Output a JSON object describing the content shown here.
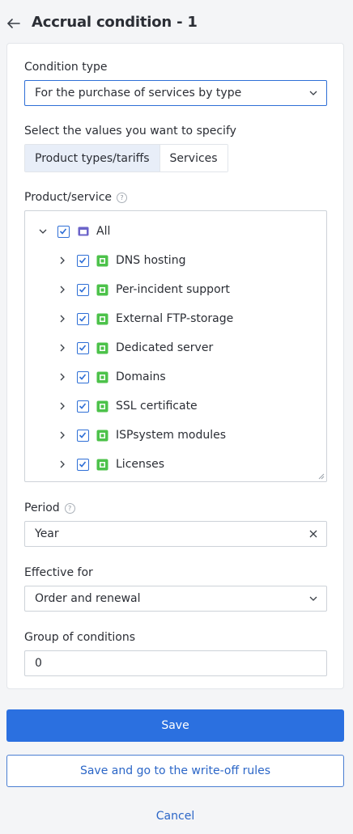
{
  "header": {
    "title": "Accrual condition - 1",
    "back_icon": "arrow-left-icon"
  },
  "condition_type": {
    "label": "Condition type",
    "value": "For the purchase of services by type"
  },
  "values_selector": {
    "label": "Select the values you want to specify",
    "options": [
      "Product types/tariffs",
      "Services"
    ],
    "selected": "Product types/tariffs"
  },
  "product_service": {
    "label": "Product/service",
    "root": {
      "label": "All",
      "checked": true
    },
    "items": [
      {
        "label": "DNS hosting",
        "checked": true
      },
      {
        "label": "Per-incident support",
        "checked": true
      },
      {
        "label": "External FTP-storage",
        "checked": true
      },
      {
        "label": "Dedicated server",
        "checked": true
      },
      {
        "label": "Domains",
        "checked": true
      },
      {
        "label": "SSL certificate",
        "checked": true
      },
      {
        "label": "ISPsystem modules",
        "checked": true
      },
      {
        "label": "Licenses",
        "checked": true
      }
    ]
  },
  "period": {
    "label": "Period",
    "value": "Year"
  },
  "effective_for": {
    "label": "Effective for",
    "value": "Order and renewal"
  },
  "group_of_conditions": {
    "label": "Group of conditions",
    "value": "0"
  },
  "actions": {
    "save": "Save",
    "save_and_go": "Save and go to the write-off rules",
    "cancel": "Cancel"
  },
  "colors": {
    "accent": "#2b70e0",
    "checkbox": "#2f6fd6",
    "folder": "#6b63c9",
    "node": "#4cc24a"
  }
}
